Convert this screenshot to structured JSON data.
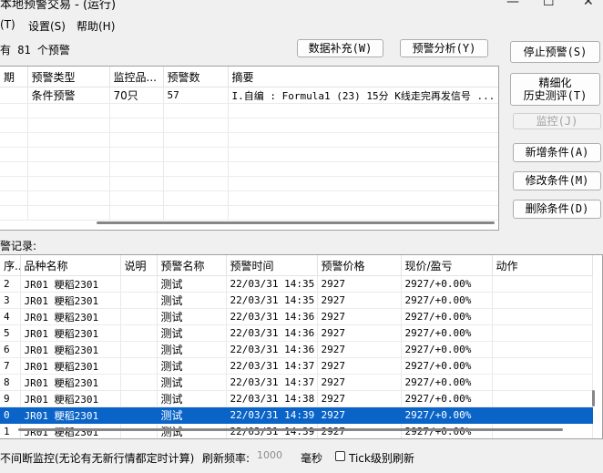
{
  "window": {
    "title": "本地预警交易 - (运行)",
    "minimize_glyph": "—",
    "maximize_glyph": "☐",
    "close_glyph": "✕"
  },
  "menu": {
    "items": [
      {
        "label": "(T)"
      },
      {
        "label": "设置(S)"
      },
      {
        "label": "帮助(H)"
      }
    ]
  },
  "top": {
    "count_text": "有 81 个预警",
    "data_supplement_button": "数据补充(W)",
    "alert_analysis_button": "预警分析(Y)"
  },
  "side_buttons": {
    "stop_alert": "停止预警(S)",
    "refined_backtest": "精细化\n历史测评(T)",
    "monitor": "监控(J)",
    "add_condition": "新增条件(A)",
    "modify_condition": "修改条件(M)",
    "delete_condition": "删除条件(D)"
  },
  "conditions_table": {
    "headers": [
      "期",
      "预警类型",
      "监控品...",
      "预警数",
      "摘要"
    ],
    "rows": [
      [
        "",
        "条件预警",
        "70只",
        "57",
        "I.自编 : Formula1 (23) 15分 K线走完再发信号 ..."
      ]
    ]
  },
  "records": {
    "label": "警记录:",
    "headers": [
      "序...",
      "品种名称",
      "说明",
      "预警名称",
      "预警时间",
      "预警价格",
      "现价/盈亏",
      "动作"
    ],
    "rows": [
      [
        "2",
        "JR01 粳稻2301",
        "",
        "测试",
        "22/03/31 14:35",
        "2927",
        "2927/+0.00%",
        ""
      ],
      [
        "3",
        "JR01 粳稻2301",
        "",
        "测试",
        "22/03/31 14:35",
        "2927",
        "2927/+0.00%",
        ""
      ],
      [
        "4",
        "JR01 粳稻2301",
        "",
        "测试",
        "22/03/31 14:36",
        "2927",
        "2927/+0.00%",
        ""
      ],
      [
        "5",
        "JR01 粳稻2301",
        "",
        "测试",
        "22/03/31 14:36",
        "2927",
        "2927/+0.00%",
        ""
      ],
      [
        "6",
        "JR01 粳稻2301",
        "",
        "测试",
        "22/03/31 14:36",
        "2927",
        "2927/+0.00%",
        ""
      ],
      [
        "7",
        "JR01 粳稻2301",
        "",
        "测试",
        "22/03/31 14:37",
        "2927",
        "2927/+0.00%",
        ""
      ],
      [
        "8",
        "JR01 粳稻2301",
        "",
        "测试",
        "22/03/31 14:37",
        "2927",
        "2927/+0.00%",
        ""
      ],
      [
        "9",
        "JR01 粳稻2301",
        "",
        "测试",
        "22/03/31 14:38",
        "2927",
        "2927/+0.00%",
        ""
      ],
      [
        "0",
        "JR01 粳稻2301",
        "",
        "测试",
        "22/03/31 14:39",
        "2927",
        "2927/+0.00%",
        ""
      ],
      [
        "1",
        "JR01 粳稻2301",
        "",
        "测试",
        "22/03/31 14:39",
        "2927",
        "2927/+0.00%",
        ""
      ]
    ],
    "selected_index": 8,
    "selection_color": "#0a64c8"
  },
  "bottom": {
    "monitor_text": "不间断监控(无论有无新行情都定时计算)",
    "refresh_label": "刷新频率:",
    "refresh_value": "1000",
    "unit": "毫秒",
    "tick_label": "Tick级别刷新",
    "tick_checked": false
  }
}
